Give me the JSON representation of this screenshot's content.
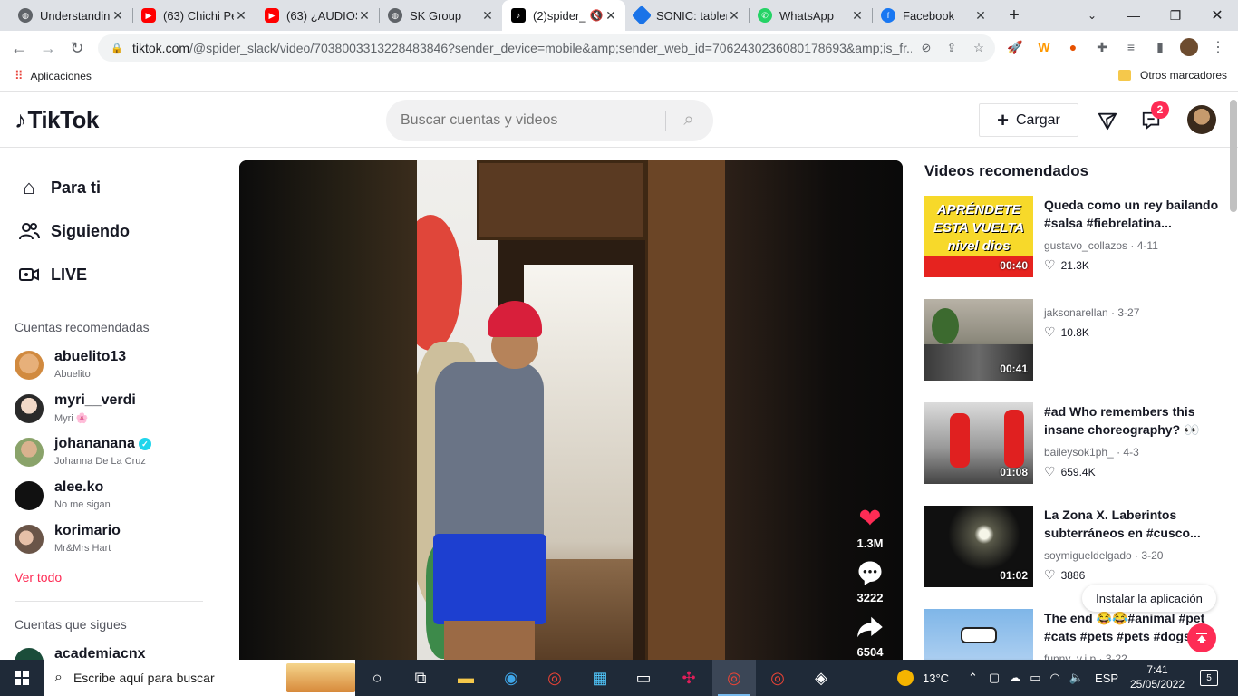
{
  "browser": {
    "tabs": [
      {
        "title": "Understandin",
        "icon": "globe-icon"
      },
      {
        "title": "(63) Chichi Pe",
        "icon": "youtube-icon"
      },
      {
        "title": "(63) ¿AUDIOS",
        "icon": "youtube-icon"
      },
      {
        "title": "SK Group",
        "icon": "globe-icon"
      },
      {
        "title": "(2)spider_",
        "icon": "tiktok-icon"
      },
      {
        "title": "SONIC: tabler",
        "icon": "diamond-icon"
      },
      {
        "title": "WhatsApp",
        "icon": "whatsapp-icon"
      },
      {
        "title": "Facebook",
        "icon": "facebook-icon"
      }
    ],
    "url_host": "tiktok.com",
    "url_rest": "/@spider_slack/video/7038003313228483846?sender_device=mobile&amp;sender_web_id=7062430236080178693&amp;is_fr...",
    "bookmarks": {
      "apps": "Aplicaciones",
      "other": "Otros marcadores"
    }
  },
  "header": {
    "logo": "TikTok",
    "search_placeholder": "Buscar cuentas y videos",
    "upload_label": "Cargar",
    "inbox_count": "2"
  },
  "sidebar": {
    "nav": [
      {
        "label": "Para ti",
        "icon": "home-icon"
      },
      {
        "label": "Siguiendo",
        "icon": "following-icon"
      },
      {
        "label": "LIVE",
        "icon": "live-icon"
      }
    ],
    "recommended_title": "Cuentas recomendadas",
    "accounts": [
      {
        "username": "abuelito13",
        "nickname": "Abuelito",
        "verified": false
      },
      {
        "username": "myri__verdi",
        "nickname": "Myri 🌸",
        "verified": false
      },
      {
        "username": "johananana",
        "nickname": "Johanna De La Cruz",
        "verified": true
      },
      {
        "username": "alee.ko",
        "nickname": "No me sigan",
        "verified": false
      },
      {
        "username": "korimario",
        "nickname": "Mr&Mrs Hart",
        "verified": false
      }
    ],
    "see_all": "Ver todo",
    "following_title": "Cuentas que sigues",
    "following_first": "academiacnx"
  },
  "video": {
    "likes": "1.3M",
    "comments": "3222",
    "shares": "6504"
  },
  "recommended": {
    "title": "Videos recomendados",
    "items": [
      {
        "title": "Queda como un rey bailando #salsa #fiebrelatina...",
        "author": "gustavo_collazos",
        "date": "4-11",
        "likes": "21.3K",
        "duration": "00:40",
        "thumb_text": "APRÉNDETE ESTA VUELTA nivel dios"
      },
      {
        "title": "",
        "author": "jaksonarellan",
        "date": "3-27",
        "likes": "10.8K",
        "duration": "00:41"
      },
      {
        "title": "#ad Who remembers this insane choreography? 👀 th...",
        "author": "baileysok1ph_",
        "date": "4-3",
        "likes": "659.4K",
        "duration": "01:08"
      },
      {
        "title": "La Zona X. Laberintos subterráneos en #cusco...",
        "author": "soymigueldelgado",
        "date": "3-20",
        "likes": "3886",
        "duration": "01:02"
      },
      {
        "title": "The end 😂😂#animal #pet #cats #pets #pets #dogs...",
        "author": "funny_v.i.p",
        "date": "3-22",
        "likes": "",
        "duration": ""
      }
    ],
    "install_label": "Instalar la aplicación"
  },
  "taskbar": {
    "search_text": "Escribe aquí para buscar",
    "weather": "13°C",
    "language": "ESP",
    "time": "7:41",
    "date": "25/05/2022",
    "notifications": "5"
  },
  "colors": {
    "accent": "#fe2c55",
    "chrome_tabbar": "#dee1e6",
    "taskbar": "#1f2a38"
  }
}
